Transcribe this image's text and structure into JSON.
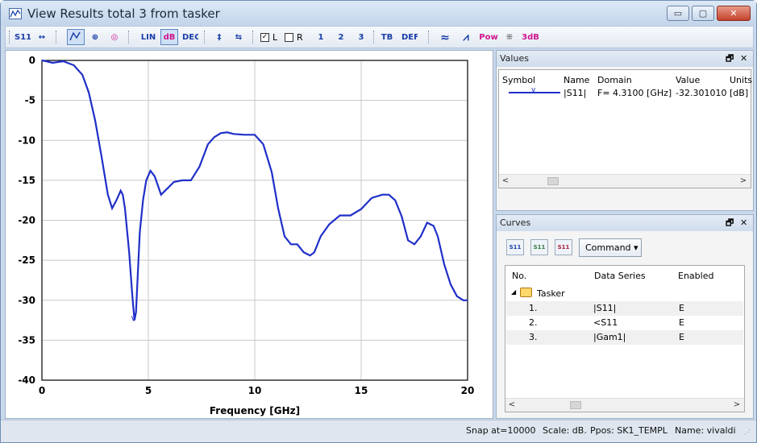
{
  "window": {
    "title": "View Results total 3 from tasker",
    "min_label": "▭",
    "max_label": "▢",
    "close_label": "✕"
  },
  "toolbar": {
    "checkbox_l_label": "L",
    "checkbox_r_label": "R",
    "checkbox_l_checked": "✓",
    "buttons": {
      "s11": "S11",
      "fit": "↔",
      "smith": "⊕",
      "polar": "◎",
      "lin": "LIN",
      "db": "dB",
      "deg": "DEG",
      "marker_a": "‡",
      "marker_b": "⇆",
      "m1": "1",
      "m2": "2",
      "m3": "3",
      "tb": "TB",
      "def": "DEF",
      "wave": "≈",
      "envelope": "⩘",
      "pow": "Pow",
      "grid": "⁜",
      "db3": "3dB"
    }
  },
  "chart_data": {
    "type": "line",
    "xlabel": "Frequency [GHz]",
    "ylabel": "",
    "xlim": [
      0,
      20
    ],
    "ylim": [
      -40,
      0
    ],
    "x_ticks": [
      "0",
      "5",
      "10",
      "15",
      "20"
    ],
    "y_ticks": [
      "0",
      "-5",
      "-10",
      "-15",
      "-20",
      "-25",
      "-30",
      "-35",
      "-40"
    ],
    "grid": true,
    "color": "#1f2fc8",
    "series": [
      {
        "name": "|S11|",
        "x": [
          0,
          0.2,
          0.5,
          1.0,
          1.5,
          1.9,
          2.2,
          2.5,
          2.8,
          3.1,
          3.3,
          3.5,
          3.7,
          3.8,
          3.9,
          4.1,
          4.25,
          4.35,
          4.42,
          4.5,
          4.6,
          4.75,
          4.9,
          5.1,
          5.3,
          5.6,
          5.9,
          6.2,
          6.6,
          7.0,
          7.4,
          7.8,
          8.1,
          8.4,
          8.7,
          9.0,
          9.5,
          10.0,
          10.4,
          10.8,
          11.1,
          11.4,
          11.7,
          12.0,
          12.3,
          12.6,
          12.8,
          13.1,
          13.5,
          14.0,
          14.5,
          15.0,
          15.5,
          16.0,
          16.3,
          16.6,
          16.9,
          17.2,
          17.5,
          17.8,
          18.1,
          18.4,
          18.6,
          18.9,
          19.2,
          19.5,
          19.8,
          20.0
        ],
        "y": [
          0,
          -0.1,
          -0.3,
          -0.1,
          -0.6,
          -1.8,
          -4.0,
          -7.5,
          -12.0,
          -16.8,
          -18.5,
          -17.5,
          -16.3,
          -16.8,
          -18.5,
          -24.0,
          -29.5,
          -32.5,
          -31.5,
          -27.0,
          -21.5,
          -17.5,
          -15.0,
          -13.8,
          -14.5,
          -16.8,
          -16.0,
          -15.2,
          -15.0,
          -15.0,
          -13.3,
          -10.5,
          -9.6,
          -9.1,
          -9.0,
          -9.2,
          -9.3,
          -9.3,
          -10.5,
          -14.0,
          -18.5,
          -22.0,
          -23.0,
          -23.0,
          -24.0,
          -24.4,
          -24.0,
          -22.0,
          -20.5,
          -19.4,
          -19.4,
          -18.6,
          -17.2,
          -16.8,
          -16.8,
          -17.5,
          -19.5,
          -22.5,
          -23.0,
          -22.0,
          -20.3,
          -20.7,
          -22.0,
          -25.5,
          -28.0,
          -29.5,
          -30.0,
          -30.0
        ]
      }
    ],
    "marker": {
      "x": 4.31,
      "y": -32.3,
      "label": "v"
    }
  },
  "values_panel": {
    "title": "Values",
    "float_icon": "🗗",
    "close_icon": "✕",
    "headers": [
      "Symbol",
      "Name",
      "Domain",
      "Value",
      "Units"
    ],
    "row": {
      "symbol_glyph": "v",
      "name": "|S11|",
      "domain": "F=  4.3100 [GHz]",
      "value": "-32.301010",
      "units": "[dB]"
    }
  },
  "curves_panel": {
    "title": "Curves",
    "float_icon": "🗗",
    "close_icon": "✕",
    "command_label": "Command ▾",
    "buttons": [
      "S11",
      "S11",
      "S11"
    ],
    "headers": [
      "No.",
      "Data Series",
      "Enabled"
    ],
    "group_label": "Tasker",
    "rows": [
      {
        "no": "1.",
        "series": "|S11|",
        "enabled": "E"
      },
      {
        "no": "2.",
        "series": "<S11",
        "enabled": "E"
      },
      {
        "no": "3.",
        "series": "|Gam1|",
        "enabled": "E"
      }
    ]
  },
  "statusbar": {
    "snap": "Snap at=10000",
    "scale": "Scale: dB.",
    "ppos": "Ppos: SK1_TEMPL",
    "name": "Name: vivaldi"
  }
}
